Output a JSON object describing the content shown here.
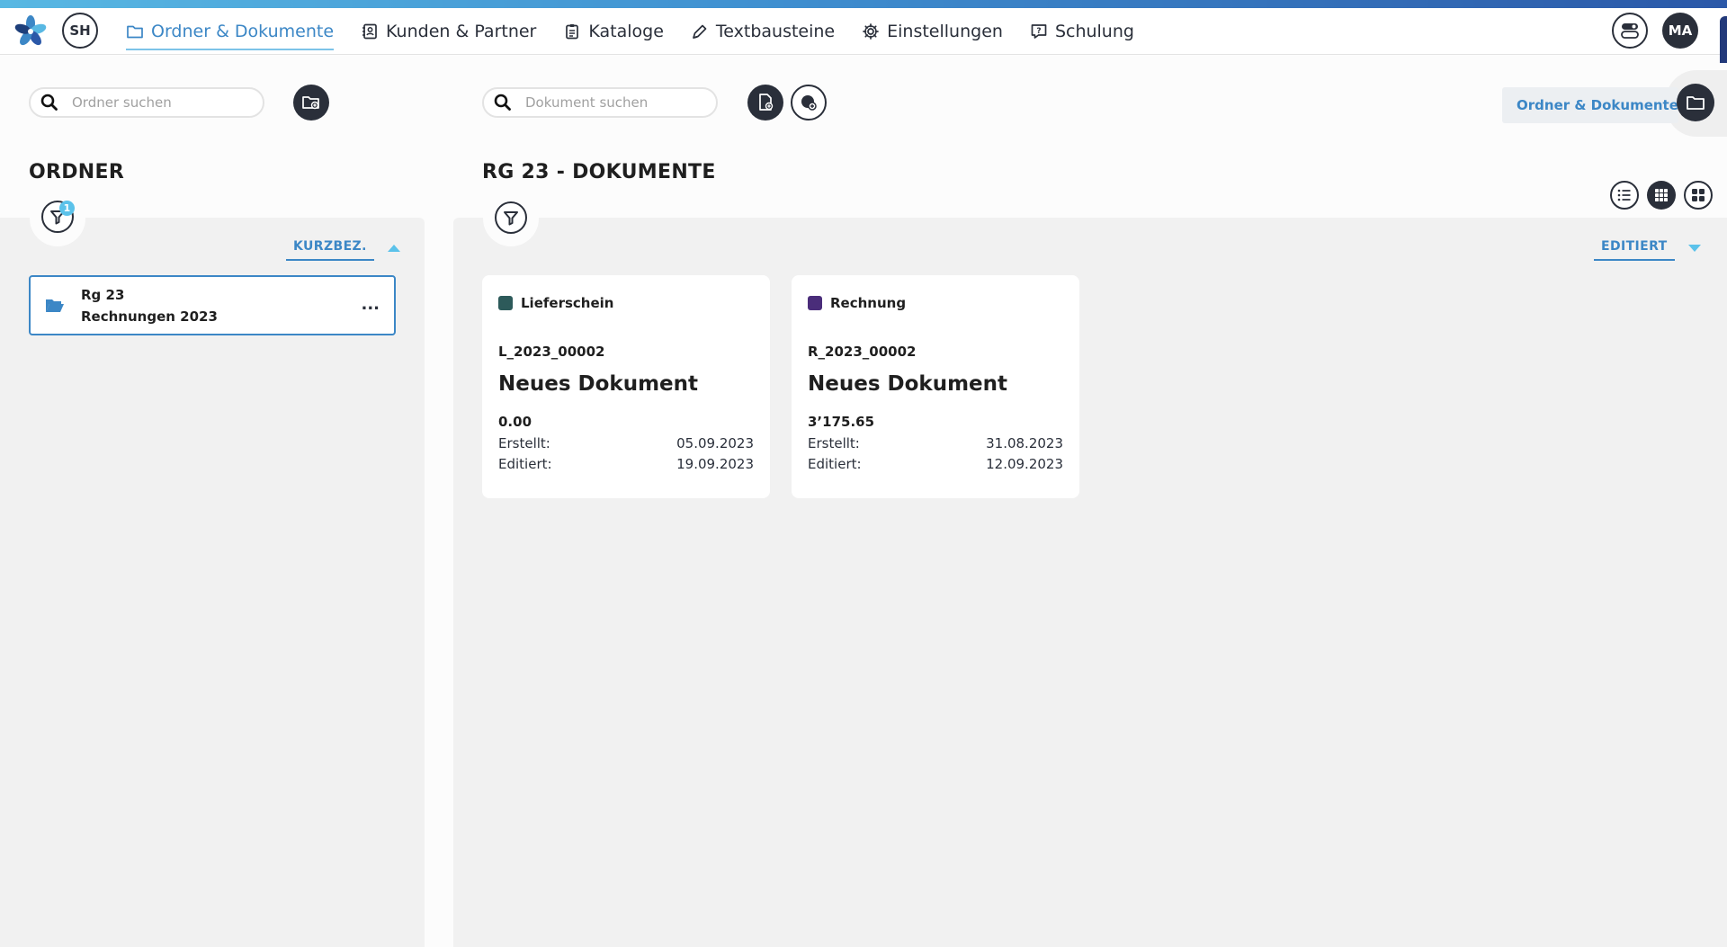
{
  "header": {
    "user_initials": "SH",
    "account_initials": "MA",
    "nav": [
      {
        "label": "Ordner & Dokumente",
        "icon": "folder-icon",
        "active": true
      },
      {
        "label": "Kunden & Partner",
        "icon": "contact-card-icon",
        "active": false
      },
      {
        "label": "Kataloge",
        "icon": "clipboard-icon",
        "active": false
      },
      {
        "label": "Textbausteine",
        "icon": "pen-icon",
        "active": false
      },
      {
        "label": "Einstellungen",
        "icon": "gear-icon",
        "active": false
      },
      {
        "label": "Schulung",
        "icon": "help-chat-icon",
        "active": false
      }
    ]
  },
  "toolbar": {
    "folder_search_placeholder": "Ordner suchen",
    "document_search_placeholder": "Dokument suchen",
    "view_tab_label": "Ordner & Dokumente"
  },
  "folders": {
    "title": "ORDNER",
    "filter_count": "1",
    "sort_label": "KURZBEZ.",
    "sort_direction": "ascending",
    "items": [
      {
        "line1": "Rg 23",
        "line2": "Rechnungen 2023",
        "more": "..."
      }
    ]
  },
  "documents": {
    "title": "RG 23 - DOKUMENTE",
    "sort_label": "EDITIERT",
    "sort_direction": "descending",
    "created_label": "Erstellt:",
    "edited_label": "Editiert:",
    "items": [
      {
        "type": "Lieferschein",
        "type_color": "#2d5a5a",
        "number": "L_2023_00002",
        "title": "Neues Dokument",
        "amount": "0.00",
        "created": "05.09.2023",
        "edited": "19.09.2023"
      },
      {
        "type": "Rechnung",
        "type_color": "#4a2d7a",
        "number": "R_2023_00002",
        "title": "Neues Dokument",
        "amount": "3’175.65",
        "created": "31.08.2023",
        "edited": "12.09.2023"
      }
    ]
  },
  "colors": {
    "accent": "#3c87c6",
    "dark": "#2a2f3a",
    "badge": "#5bc2ea"
  }
}
